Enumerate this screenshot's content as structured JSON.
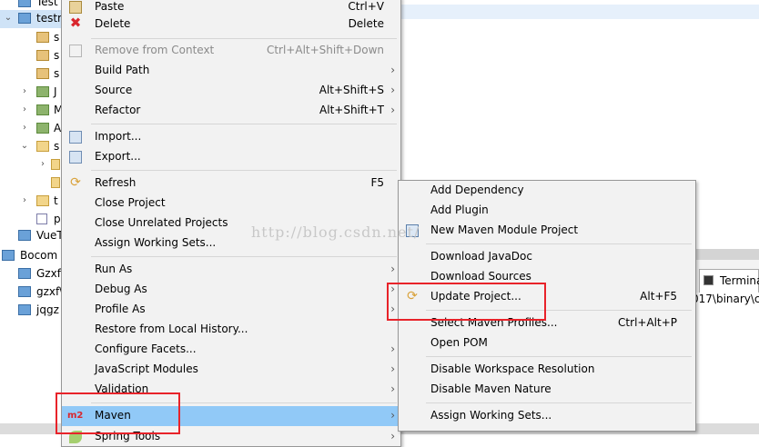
{
  "tree": [
    {
      "label": "Test",
      "icon": "project-icon",
      "twisty": ""
    },
    {
      "label": "testm",
      "icon": "maven-project-icon",
      "twisty": "expanded"
    },
    {
      "label": "s",
      "icon": "package-icon",
      "twisty": ""
    },
    {
      "label": "s",
      "icon": "package-icon",
      "twisty": ""
    },
    {
      "label": "s",
      "icon": "package-icon",
      "twisty": ""
    },
    {
      "label": "J",
      "icon": "library-icon",
      "twisty": "collapsed"
    },
    {
      "label": "M",
      "icon": "library-icon",
      "twisty": "collapsed"
    },
    {
      "label": "A",
      "icon": "library-icon",
      "twisty": "collapsed"
    },
    {
      "label": "s",
      "icon": "folder-icon",
      "twisty": "expanded"
    },
    {
      "label": "",
      "icon": "folder-icon",
      "twisty": "collapsed"
    },
    {
      "label": "",
      "icon": "folder-icon",
      "twisty": ""
    },
    {
      "label": "t",
      "icon": "folder-icon",
      "twisty": "collapsed"
    },
    {
      "label": "p",
      "icon": "file-icon",
      "twisty": ""
    },
    {
      "label": "VueT",
      "icon": "project-icon",
      "twisty": ""
    },
    {
      "label": "Bocom",
      "icon": "project-icon",
      "twisty": ""
    },
    {
      "label": "Gzxfl",
      "icon": "project-icon",
      "twisty": ""
    },
    {
      "label": "gzxf\\",
      "icon": "project-icon",
      "twisty": ""
    },
    {
      "label": "jqgz",
      "icon": "project-icon",
      "twisty": ""
    }
  ],
  "terminal_tab": {
    "label": "Termina"
  },
  "console_path": "017\\binary\\c",
  "context_menu": {
    "items": [
      {
        "label": "Paste",
        "accel": "Ctrl+V",
        "icon": "paste-icon"
      },
      {
        "label": "Delete",
        "accel": "Delete",
        "icon": "delete-icon"
      },
      {
        "label": "Remove from Context",
        "accel": "Ctrl+Alt+Shift+Down",
        "icon": "remove-context-icon",
        "disabled": true
      },
      {
        "label": "Build Path",
        "accel": "",
        "submenu": true
      },
      {
        "label": "Source",
        "accel": "Alt+Shift+S",
        "submenu": true
      },
      {
        "label": "Refactor",
        "accel": "Alt+Shift+T",
        "submenu": true
      },
      {
        "label": "Import...",
        "accel": "",
        "icon": "import-icon"
      },
      {
        "label": "Export...",
        "accel": "",
        "icon": "export-icon"
      },
      {
        "label": "Refresh",
        "accel": "F5",
        "icon": "refresh-icon"
      },
      {
        "label": "Close Project",
        "accel": ""
      },
      {
        "label": "Close Unrelated Projects",
        "accel": ""
      },
      {
        "label": "Assign Working Sets...",
        "accel": ""
      },
      {
        "label": "Run As",
        "accel": "",
        "submenu": true
      },
      {
        "label": "Debug As",
        "accel": "",
        "submenu": true
      },
      {
        "label": "Profile As",
        "accel": "",
        "submenu": true
      },
      {
        "label": "Restore from Local History...",
        "accel": ""
      },
      {
        "label": "Configure Facets...",
        "accel": "",
        "submenu": true
      },
      {
        "label": "JavaScript Modules",
        "accel": "",
        "submenu": true
      },
      {
        "label": "Validation",
        "accel": "",
        "submenu": true
      },
      {
        "label": "Maven",
        "accel": "",
        "submenu": true,
        "icon": "maven-icon",
        "icon_text": "m2",
        "highlighted": true
      },
      {
        "label": "Spring Tools",
        "accel": "",
        "submenu": true,
        "icon": "spring-icon"
      }
    ]
  },
  "maven_submenu": {
    "items": [
      {
        "label": "Add Dependency",
        "accel": ""
      },
      {
        "label": "Add Plugin",
        "accel": ""
      },
      {
        "label": "New Maven Module Project",
        "accel": "",
        "icon": "maven-module-icon"
      },
      {
        "label": "Download JavaDoc",
        "accel": ""
      },
      {
        "label": "Download Sources",
        "accel": ""
      },
      {
        "label": "Update Project...",
        "accel": "Alt+F5",
        "icon": "update-project-icon"
      },
      {
        "label": "Select Maven Profiles...",
        "accel": "Ctrl+Alt+P"
      },
      {
        "label": "Open POM",
        "accel": ""
      },
      {
        "label": "Disable Workspace Resolution",
        "accel": ""
      },
      {
        "label": "Disable Maven Nature",
        "accel": ""
      },
      {
        "label": "Assign Working Sets...",
        "accel": ""
      }
    ]
  },
  "watermark": "http://blog.csdn.net/",
  "colors": {
    "highlight": "#91c9f7",
    "annotation": "#e8232a",
    "menu_bg": "#f2f2f2"
  }
}
